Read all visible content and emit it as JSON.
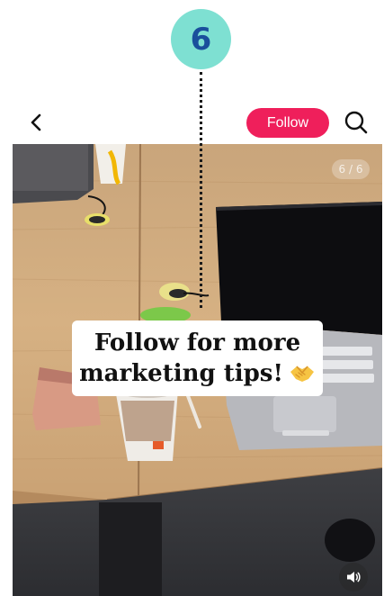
{
  "step_marker": {
    "number": "6",
    "color": "#7ee0d2",
    "text_color": "#1a4f9c"
  },
  "header": {
    "back_icon": "chevron-left-icon",
    "follow_label": "Follow",
    "follow_color": "#ef1f5b",
    "search_icon": "search-icon"
  },
  "post": {
    "page_counter": "6 / 6",
    "caption_line1": "Follow for more",
    "caption_line2": "marketing tips!",
    "caption_emoji": "handshake-emoji",
    "volume_icon": "speaker-icon"
  }
}
